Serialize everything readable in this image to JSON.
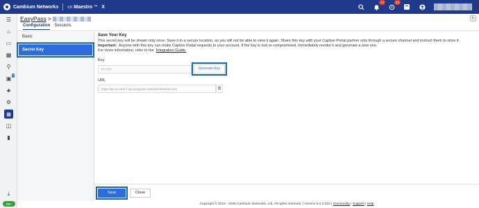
{
  "topbar": {
    "brand": "Cambium Networks",
    "product_prefix": "cn",
    "product_name": "Maestro",
    "product_tm": "™",
    "product_x": "X",
    "badges": {
      "alerts": "12",
      "notifications": "22"
    }
  },
  "sidebar": {
    "device_badge": "3",
    "bottom_pill": "99+"
  },
  "header": {
    "breadcrumb_root": "EasyPass",
    "breadcrumb_sep": ">",
    "tabs": [
      {
        "label": "Configuration"
      },
      {
        "label": "Sessions"
      }
    ]
  },
  "leftnav": {
    "items": [
      {
        "label": "Basic"
      },
      {
        "label": "Secret Key"
      }
    ]
  },
  "content": {
    "title": "Save Your Key",
    "description": "This secret key will be shown only once. Save it in a secure location, as you will not be able to view it again. Share this key with your Captive Portal partner only through a secure channel and instruct them to store it.",
    "important_label": "Important:",
    "important_text": "Anyone with this key can make Captive Portal requests to your account. If the key is lost or compromised, immediately revoke it and generate a new one.",
    "more_info": "For more information, refer to the",
    "guide_link": "Integration Guide.",
    "key_label": "Key",
    "key_placeholder": "No Key",
    "generate_label": "Generate Key",
    "url_label": "URL",
    "url_value": "https://api.us-east-1.api.easypass.cambiumnetworks.com"
  },
  "footer": {
    "save_label": "Save",
    "close_label": "Close"
  },
  "copyright": {
    "text": "Copyright © 2015 - 2025 Cambium Networks, Ltd. All rights reserved.",
    "version": "Version 5.2.2 b34",
    "community": "Community",
    "support": "Support",
    "help": "Help",
    "divider": "|"
  }
}
